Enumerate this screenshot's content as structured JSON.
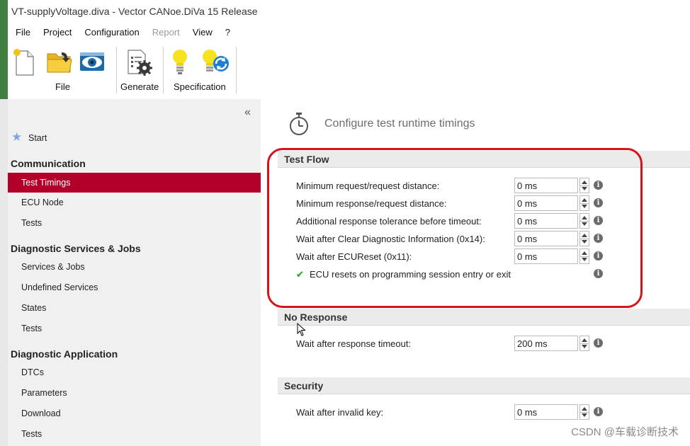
{
  "window": {
    "title": "VT-supplyVoltage.diva - Vector CANoe.DiVa 15 Release"
  },
  "menu": {
    "items": [
      {
        "label": "File",
        "enabled": true
      },
      {
        "label": "Project",
        "enabled": true
      },
      {
        "label": "Configuration",
        "enabled": true
      },
      {
        "label": "Report",
        "enabled": false
      },
      {
        "label": "View",
        "enabled": true
      },
      {
        "label": "?",
        "enabled": true
      }
    ]
  },
  "ribbon": {
    "groups": [
      {
        "label": "File",
        "icons": [
          "new-document-icon",
          "open-folder-icon",
          "view-eye-icon"
        ]
      },
      {
        "label": "Generate",
        "icons": [
          "generate-gear-icon"
        ]
      },
      {
        "label": "Specification",
        "icons": [
          "lightbulb-icon",
          "lightbulb-refresh-icon"
        ]
      }
    ]
  },
  "sidebar": {
    "collapse_glyph": "«",
    "start_label": "Start",
    "sections": [
      {
        "heading": "Communication",
        "items": [
          {
            "label": "Test Timings",
            "selected": true
          },
          {
            "label": "ECU Node",
            "selected": false
          },
          {
            "label": "Tests",
            "selected": false
          }
        ]
      },
      {
        "heading": "Diagnostic Services & Jobs",
        "items": [
          {
            "label": "Services & Jobs",
            "selected": false
          },
          {
            "label": "Undefined Services",
            "selected": false
          },
          {
            "label": "States",
            "selected": false
          },
          {
            "label": "Tests",
            "selected": false
          }
        ]
      },
      {
        "heading": "Diagnostic Application",
        "items": [
          {
            "label": "DTCs",
            "selected": false
          },
          {
            "label": "Parameters",
            "selected": false
          },
          {
            "label": "Download",
            "selected": false
          },
          {
            "label": "Tests",
            "selected": false
          }
        ]
      }
    ]
  },
  "main": {
    "title": "Configure test runtime timings",
    "sections": [
      {
        "heading": "Test Flow",
        "rows": [
          {
            "label": "Minimum request/request distance:",
            "value": "0 ms"
          },
          {
            "label": "Minimum response/request distance:",
            "value": "0 ms"
          },
          {
            "label": "Additional response tolerance before timeout:",
            "value": "0 ms"
          },
          {
            "label": "Wait after Clear Diagnostic Information (0x14):",
            "value": "0 ms"
          },
          {
            "label": "Wait after ECUReset (0x11):",
            "value": "0 ms"
          }
        ],
        "checkbox": {
          "label": "ECU resets on programming session entry or exit",
          "checked": true
        }
      },
      {
        "heading": "No Response",
        "rows": [
          {
            "label": "Wait after response timeout:",
            "value": "200 ms"
          }
        ]
      },
      {
        "heading": "Security",
        "rows": [
          {
            "label": "Wait after invalid key:",
            "value": "0 ms"
          }
        ]
      }
    ],
    "info_glyph": "i"
  },
  "watermark": "CSDN @车载诊断技术",
  "colors": {
    "selection": "#b2002a",
    "annotation": "#d4151d",
    "sidebar_bg": "#f0f0f0",
    "section_bg": "#ebebeb"
  }
}
